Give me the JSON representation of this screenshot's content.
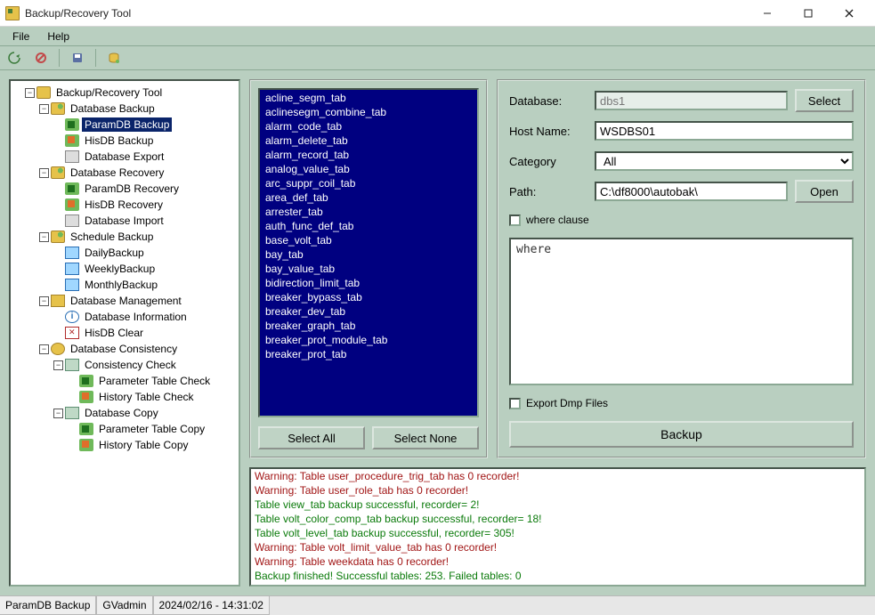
{
  "window": {
    "title": "Backup/Recovery Tool"
  },
  "menu": {
    "file": "File",
    "help": "Help"
  },
  "tree": {
    "root": "Backup/Recovery Tool",
    "db_backup": "Database Backup",
    "param_backup": "ParamDB Backup",
    "his_backup": "HisDB Backup",
    "db_export": "Database Export",
    "db_recovery": "Database Recovery",
    "param_recovery": "ParamDB Recovery",
    "his_recovery": "HisDB Recovery",
    "db_import": "Database Import",
    "sched_backup": "Schedule Backup",
    "daily": "DailyBackup",
    "weekly": "WeeklyBackup",
    "monthly": "MonthlyBackup",
    "db_mgmt": "Database Management",
    "db_info": "Database Information",
    "his_clear": "HisDB Clear",
    "db_cons": "Database Consistency",
    "cons_check": "Consistency Check",
    "param_check": "Parameter Table Check",
    "hist_check": "History Table Check",
    "db_copy": "Database Copy",
    "param_copy": "Parameter Table Copy",
    "hist_copy": "History Table Copy"
  },
  "tables": [
    "acline_segm_tab",
    "aclinesegm_combine_tab",
    "alarm_code_tab",
    "alarm_delete_tab",
    "alarm_record_tab",
    "analog_value_tab",
    "arc_suppr_coil_tab",
    "area_def_tab",
    "arrester_tab",
    "auth_func_def_tab",
    "base_volt_tab",
    "bay_tab",
    "bay_value_tab",
    "bidirection_limit_tab",
    "breaker_bypass_tab",
    "breaker_dev_tab",
    "breaker_graph_tab",
    "breaker_prot_module_tab",
    "breaker_prot_tab"
  ],
  "buttons": {
    "select_all": "Select All",
    "select_none": "Select None",
    "select": "Select",
    "open": "Open",
    "backup": "Backup"
  },
  "form": {
    "database_label": "Database:",
    "database": "dbs1",
    "hostname_label": "Host Name:",
    "hostname": "WSDBS01",
    "category_label": "Category",
    "category": "All",
    "path_label": "Path:",
    "path": "C:\\df8000\\autobak\\",
    "where_chk": "where clause",
    "where_text": "where",
    "export_chk": "Export Dmp Files"
  },
  "log": [
    {
      "t": "Warning: Table user_procedure_trig_tab has 0 recorder!",
      "c": "warn"
    },
    {
      "t": "Warning: Table user_role_tab has 0 recorder!",
      "c": "warn"
    },
    {
      "t": "Table view_tab backup successful, recorder= 2!",
      "c": "ok"
    },
    {
      "t": "Table volt_color_comp_tab backup successful, recorder= 18!",
      "c": "ok"
    },
    {
      "t": "Table volt_level_tab backup successful, recorder= 305!",
      "c": "ok"
    },
    {
      "t": "Warning: Table volt_limit_value_tab has 0 recorder!",
      "c": "warn"
    },
    {
      "t": "Warning: Table weekdata has 0 recorder!",
      "c": "warn"
    },
    {
      "t": "Backup finished! Successful tables: 253. Failed tables: 0",
      "c": "ok"
    }
  ],
  "status": {
    "mode": "ParamDB Backup",
    "user": "GVadmin",
    "ts": "2024/02/16 - 14:31:02"
  }
}
